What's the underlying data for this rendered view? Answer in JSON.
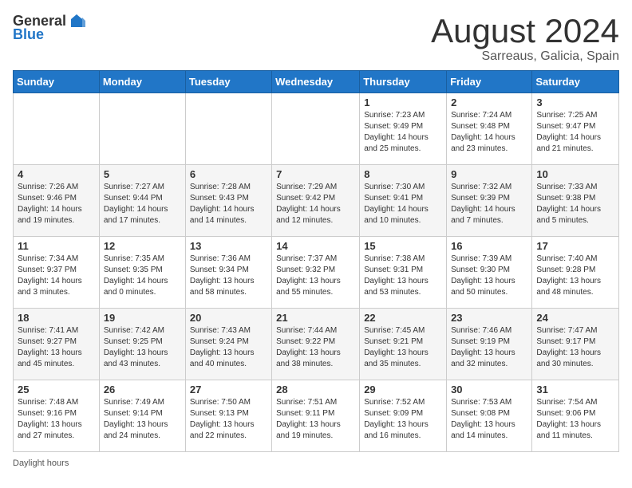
{
  "header": {
    "logo_general": "General",
    "logo_blue": "Blue",
    "title": "August 2024",
    "subtitle": "Sarreaus, Galicia, Spain"
  },
  "days_of_week": [
    "Sunday",
    "Monday",
    "Tuesday",
    "Wednesday",
    "Thursday",
    "Friday",
    "Saturday"
  ],
  "weeks": [
    [
      {
        "day": "",
        "info": ""
      },
      {
        "day": "",
        "info": ""
      },
      {
        "day": "",
        "info": ""
      },
      {
        "day": "",
        "info": ""
      },
      {
        "day": "1",
        "info": "Sunrise: 7:23 AM\nSunset: 9:49 PM\nDaylight: 14 hours and 25 minutes."
      },
      {
        "day": "2",
        "info": "Sunrise: 7:24 AM\nSunset: 9:48 PM\nDaylight: 14 hours and 23 minutes."
      },
      {
        "day": "3",
        "info": "Sunrise: 7:25 AM\nSunset: 9:47 PM\nDaylight: 14 hours and 21 minutes."
      }
    ],
    [
      {
        "day": "4",
        "info": "Sunrise: 7:26 AM\nSunset: 9:46 PM\nDaylight: 14 hours and 19 minutes."
      },
      {
        "day": "5",
        "info": "Sunrise: 7:27 AM\nSunset: 9:44 PM\nDaylight: 14 hours and 17 minutes."
      },
      {
        "day": "6",
        "info": "Sunrise: 7:28 AM\nSunset: 9:43 PM\nDaylight: 14 hours and 14 minutes."
      },
      {
        "day": "7",
        "info": "Sunrise: 7:29 AM\nSunset: 9:42 PM\nDaylight: 14 hours and 12 minutes."
      },
      {
        "day": "8",
        "info": "Sunrise: 7:30 AM\nSunset: 9:41 PM\nDaylight: 14 hours and 10 minutes."
      },
      {
        "day": "9",
        "info": "Sunrise: 7:32 AM\nSunset: 9:39 PM\nDaylight: 14 hours and 7 minutes."
      },
      {
        "day": "10",
        "info": "Sunrise: 7:33 AM\nSunset: 9:38 PM\nDaylight: 14 hours and 5 minutes."
      }
    ],
    [
      {
        "day": "11",
        "info": "Sunrise: 7:34 AM\nSunset: 9:37 PM\nDaylight: 14 hours and 3 minutes."
      },
      {
        "day": "12",
        "info": "Sunrise: 7:35 AM\nSunset: 9:35 PM\nDaylight: 14 hours and 0 minutes."
      },
      {
        "day": "13",
        "info": "Sunrise: 7:36 AM\nSunset: 9:34 PM\nDaylight: 13 hours and 58 minutes."
      },
      {
        "day": "14",
        "info": "Sunrise: 7:37 AM\nSunset: 9:32 PM\nDaylight: 13 hours and 55 minutes."
      },
      {
        "day": "15",
        "info": "Sunrise: 7:38 AM\nSunset: 9:31 PM\nDaylight: 13 hours and 53 minutes."
      },
      {
        "day": "16",
        "info": "Sunrise: 7:39 AM\nSunset: 9:30 PM\nDaylight: 13 hours and 50 minutes."
      },
      {
        "day": "17",
        "info": "Sunrise: 7:40 AM\nSunset: 9:28 PM\nDaylight: 13 hours and 48 minutes."
      }
    ],
    [
      {
        "day": "18",
        "info": "Sunrise: 7:41 AM\nSunset: 9:27 PM\nDaylight: 13 hours and 45 minutes."
      },
      {
        "day": "19",
        "info": "Sunrise: 7:42 AM\nSunset: 9:25 PM\nDaylight: 13 hours and 43 minutes."
      },
      {
        "day": "20",
        "info": "Sunrise: 7:43 AM\nSunset: 9:24 PM\nDaylight: 13 hours and 40 minutes."
      },
      {
        "day": "21",
        "info": "Sunrise: 7:44 AM\nSunset: 9:22 PM\nDaylight: 13 hours and 38 minutes."
      },
      {
        "day": "22",
        "info": "Sunrise: 7:45 AM\nSunset: 9:21 PM\nDaylight: 13 hours and 35 minutes."
      },
      {
        "day": "23",
        "info": "Sunrise: 7:46 AM\nSunset: 9:19 PM\nDaylight: 13 hours and 32 minutes."
      },
      {
        "day": "24",
        "info": "Sunrise: 7:47 AM\nSunset: 9:17 PM\nDaylight: 13 hours and 30 minutes."
      }
    ],
    [
      {
        "day": "25",
        "info": "Sunrise: 7:48 AM\nSunset: 9:16 PM\nDaylight: 13 hours and 27 minutes."
      },
      {
        "day": "26",
        "info": "Sunrise: 7:49 AM\nSunset: 9:14 PM\nDaylight: 13 hours and 24 minutes."
      },
      {
        "day": "27",
        "info": "Sunrise: 7:50 AM\nSunset: 9:13 PM\nDaylight: 13 hours and 22 minutes."
      },
      {
        "day": "28",
        "info": "Sunrise: 7:51 AM\nSunset: 9:11 PM\nDaylight: 13 hours and 19 minutes."
      },
      {
        "day": "29",
        "info": "Sunrise: 7:52 AM\nSunset: 9:09 PM\nDaylight: 13 hours and 16 minutes."
      },
      {
        "day": "30",
        "info": "Sunrise: 7:53 AM\nSunset: 9:08 PM\nDaylight: 13 hours and 14 minutes."
      },
      {
        "day": "31",
        "info": "Sunrise: 7:54 AM\nSunset: 9:06 PM\nDaylight: 13 hours and 11 minutes."
      }
    ]
  ],
  "footer": {
    "daylight_label": "Daylight hours"
  }
}
